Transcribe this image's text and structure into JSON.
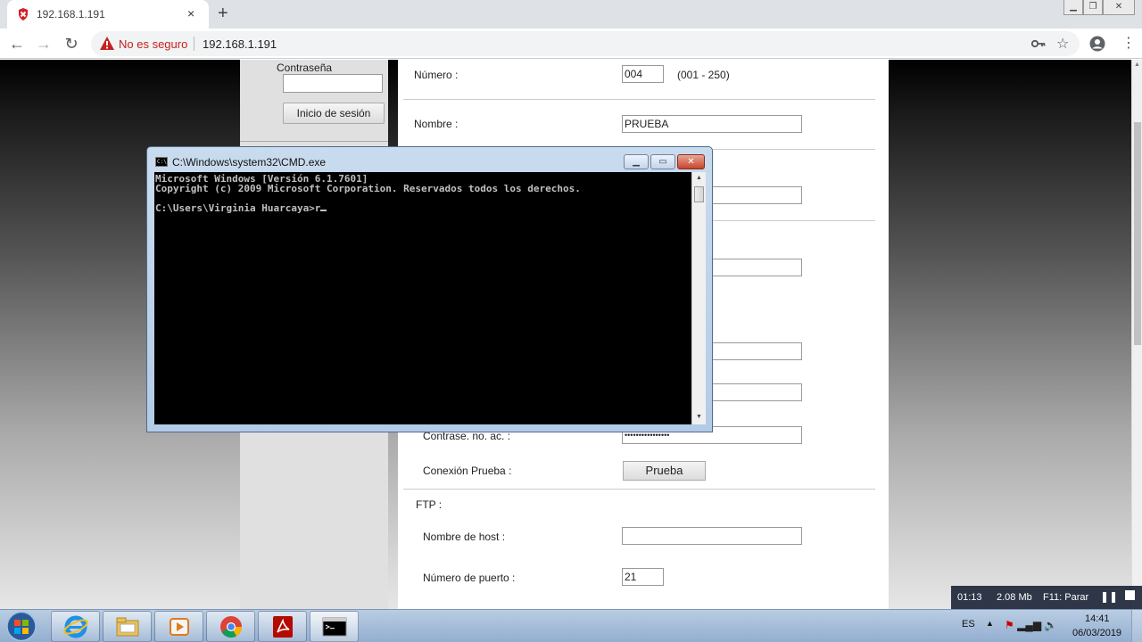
{
  "browser": {
    "tab_title": "192.168.1.191",
    "tab_close": "×",
    "new_tab": "+",
    "not_secure": "No es seguro",
    "url": "192.168.1.191"
  },
  "sidebar": {
    "password_label": "Contraseña",
    "login_button": "Inicio de sesión"
  },
  "form": {
    "numero_label": "Número :",
    "numero_value": "004",
    "numero_range": "(001  -  250)",
    "nombre_label": "Nombre :",
    "nombre_value": "PRUEBA",
    "contrasena_label": "Contrase. no. ac. :",
    "contrasena_value": "••••••••••••••••",
    "conexion_label": "Conexión Prueba :",
    "prueba_button": "Prueba",
    "ftp_heading": "FTP :",
    "host_label": "Nombre de host :",
    "host_value": "",
    "puerto_label": "Número de puerto :",
    "puerto_value": "21"
  },
  "cmd": {
    "title": "C:\\Windows\\system32\\CMD.exe",
    "icon_text": "C:\\",
    "line1": "Microsoft Windows [Versión 6.1.7601]",
    "line2": "Copyright (c) 2009 Microsoft Corporation. Reservados todos los derechos.",
    "prompt": "C:\\Users\\Virginia Huarcaya>r"
  },
  "recorder": {
    "time": "01:13",
    "size": "2.08 Mb",
    "hotkey": "F11: Parar"
  },
  "taskbar": {
    "language": "ES",
    "clock_time": "14:41",
    "clock_date": "06/03/2019"
  }
}
